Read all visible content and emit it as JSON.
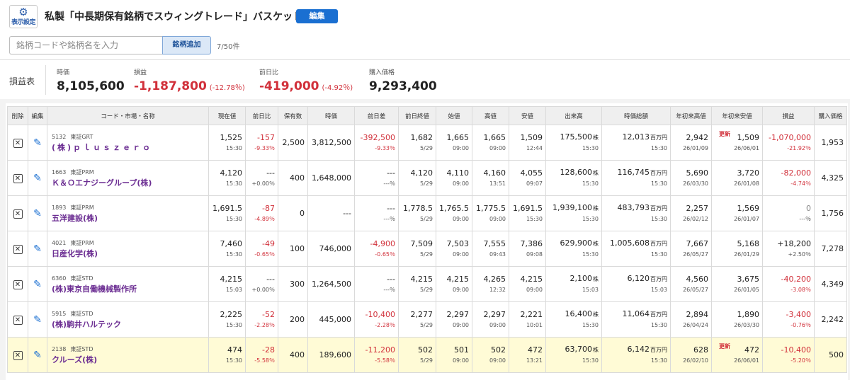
{
  "header": {
    "settings_label": "表示設定",
    "title": "私製「中長期保有銘柄でスウィングトレード」バスケット",
    "edit_label": "編集"
  },
  "search": {
    "placeholder": "銘柄コードや銘柄名を入力",
    "value": "",
    "add_label": "銘柄追加",
    "count": "7/50件"
  },
  "summary": {
    "label": "損益表",
    "market_value_label": "時価",
    "market_value": "8,105,600",
    "pl_label": "損益",
    "pl": "-1,187,800",
    "pl_pct": "(-12.78％)",
    "dod_label": "前日比",
    "dod": "-419,000",
    "dod_pct": "(-4.92％)",
    "cost_label": "購入価格",
    "cost": "9,293,400"
  },
  "table": {
    "headers": {
      "delete": "削除",
      "edit": "編集",
      "name": "コード・市場・名称",
      "price": "現在値",
      "change": "前日比",
      "qty": "保有数",
      "value": "時価",
      "diff": "前日差",
      "prev": "前日終値",
      "open": "始値",
      "high": "高値",
      "low": "安値",
      "volume": "出来高",
      "mcap": "時価総額",
      "ytd_high": "年初来高値",
      "ytd_low": "年初来安値",
      "pl": "損益",
      "cost": "購入価格"
    },
    "rows": [
      {
        "code": "5132",
        "market": "東証GRT",
        "name": "(株)ｐｌｕｓｚｅｒｏ",
        "price": "1,525",
        "price_time": "15:30",
        "chg": "-157",
        "chg_pct": "-9.33％",
        "qty": "2,500",
        "value": "3,812,500",
        "diff": "-392,500",
        "diff_pct": "-9.33％",
        "prev": "1,682",
        "prev_date": "5/29",
        "open": "1,665",
        "open_time": "09:00",
        "high": "1,665",
        "high_time": "09:00",
        "low": "1,509",
        "low_time": "12:44",
        "vol": "175,500",
        "vol_unit": "株",
        "vol_time": "15:30",
        "mcap": "12,013",
        "mcap_unit": "百万円",
        "mcap_time": "15:30",
        "ytdh": "2,942",
        "ytdh_date": "26/01/09",
        "ytdl_badge": "更新",
        "ytdl": "1,509",
        "ytdl_date": "26/06/01",
        "pl": "-1,070,000",
        "pl_pct": "-21.92％",
        "cost": "1,953"
      },
      {
        "code": "1663",
        "market": "東証PRM",
        "name": "Ｋ＆Ｏエナジーグループ(株)",
        "price": "4,120",
        "price_time": "15:30",
        "chg": "---",
        "chg_pct": "+0.00％",
        "qty": "400",
        "value": "1,648,000",
        "diff": "---",
        "diff_pct": "---％",
        "prev": "4,120",
        "prev_date": "5/29",
        "open": "4,110",
        "open_time": "09:00",
        "high": "4,160",
        "high_time": "13:51",
        "low": "4,055",
        "low_time": "09:07",
        "vol": "128,600",
        "vol_unit": "株",
        "vol_time": "15:30",
        "mcap": "116,745",
        "mcap_unit": "百万円",
        "mcap_time": "15:30",
        "ytdh": "5,690",
        "ytdh_date": "26/03/30",
        "ytdl_badge": "",
        "ytdl": "3,720",
        "ytdl_date": "26/01/08",
        "pl": "-82,000",
        "pl_pct": "-4.74％",
        "cost": "4,325"
      },
      {
        "code": "1893",
        "market": "東証PRM",
        "name": "五洋建設(株)",
        "price": "1,691.5",
        "price_time": "15:30",
        "chg": "-87",
        "chg_pct": "-4.89％",
        "qty": "0",
        "value": "---",
        "diff": "---",
        "diff_pct": "---％",
        "prev": "1,778.5",
        "prev_date": "5/29",
        "open": "1,765.5",
        "open_time": "09:00",
        "high": "1,775.5",
        "high_time": "09:00",
        "low": "1,691.5",
        "low_time": "15:30",
        "vol": "1,939,100",
        "vol_unit": "株",
        "vol_time": "15:30",
        "mcap": "483,793",
        "mcap_unit": "百万円",
        "mcap_time": "15:30",
        "ytdh": "2,257",
        "ytdh_date": "26/02/12",
        "ytdl_badge": "",
        "ytdl": "1,569",
        "ytdl_date": "26/01/07",
        "pl": "0",
        "pl_pct": "---％",
        "cost": "1,756"
      },
      {
        "code": "4021",
        "market": "東証PRM",
        "name": "日産化学(株)",
        "price": "7,460",
        "price_time": "15:30",
        "chg": "-49",
        "chg_pct": "-0.65％",
        "qty": "100",
        "value": "746,000",
        "diff": "-4,900",
        "diff_pct": "-0.65％",
        "prev": "7,509",
        "prev_date": "5/29",
        "open": "7,503",
        "open_time": "09:00",
        "high": "7,555",
        "high_time": "09:43",
        "low": "7,386",
        "low_time": "09:08",
        "vol": "629,900",
        "vol_unit": "株",
        "vol_time": "15:30",
        "mcap": "1,005,608",
        "mcap_unit": "百万円",
        "mcap_time": "15:30",
        "ytdh": "7,667",
        "ytdh_date": "26/05/27",
        "ytdl_badge": "",
        "ytdl": "5,168",
        "ytdl_date": "26/01/29",
        "pl": "+18,200",
        "pl_pct": "+2.50％",
        "cost": "7,278"
      },
      {
        "code": "6360",
        "market": "東証STD",
        "name": "(株)東京自働機械製作所",
        "price": "4,215",
        "price_time": "15:03",
        "chg": "---",
        "chg_pct": "+0.00％",
        "qty": "300",
        "value": "1,264,500",
        "diff": "---",
        "diff_pct": "---％",
        "prev": "4,215",
        "prev_date": "5/29",
        "open": "4,215",
        "open_time": "09:00",
        "high": "4,265",
        "high_time": "12:32",
        "low": "4,215",
        "low_time": "09:00",
        "vol": "2,100",
        "vol_unit": "株",
        "vol_time": "15:03",
        "mcap": "6,120",
        "mcap_unit": "百万円",
        "mcap_time": "15:03",
        "ytdh": "4,560",
        "ytdh_date": "26/05/27",
        "ytdl_badge": "",
        "ytdl": "3,675",
        "ytdl_date": "26/01/05",
        "pl": "-40,200",
        "pl_pct": "-3.08％",
        "cost": "4,349"
      },
      {
        "code": "5915",
        "market": "東証STD",
        "name": "(株)駒井ハルテック",
        "price": "2,225",
        "price_time": "15:30",
        "chg": "-52",
        "chg_pct": "-2.28％",
        "qty": "200",
        "value": "445,000",
        "diff": "-10,400",
        "diff_pct": "-2.28％",
        "prev": "2,277",
        "prev_date": "5/29",
        "open": "2,297",
        "open_time": "09:00",
        "high": "2,297",
        "high_time": "09:00",
        "low": "2,221",
        "low_time": "10:01",
        "vol": "16,400",
        "vol_unit": "株",
        "vol_time": "15:30",
        "mcap": "11,064",
        "mcap_unit": "百万円",
        "mcap_time": "15:30",
        "ytdh": "2,894",
        "ytdh_date": "26/04/24",
        "ytdl_badge": "",
        "ytdl": "1,890",
        "ytdl_date": "26/03/30",
        "pl": "-3,400",
        "pl_pct": "-0.76％",
        "cost": "2,242"
      },
      {
        "code": "2138",
        "market": "東証STD",
        "name": "クルーズ(株)",
        "price": "474",
        "price_time": "15:30",
        "chg": "-28",
        "chg_pct": "-5.58％",
        "qty": "400",
        "value": "189,600",
        "diff": "-11,200",
        "diff_pct": "-5.58％",
        "prev": "502",
        "prev_date": "5/29",
        "open": "501",
        "open_time": "09:00",
        "high": "502",
        "high_time": "09:00",
        "low": "472",
        "low_time": "13:21",
        "vol": "63,700",
        "vol_unit": "株",
        "vol_time": "15:30",
        "mcap": "6,142",
        "mcap_unit": "百万円",
        "mcap_time": "15:30",
        "ytdh": "628",
        "ytdh_date": "26/02/10",
        "ytdl_badge": "更新",
        "ytdl": "472",
        "ytdl_date": "26/06/01",
        "pl": "-10,400",
        "pl_pct": "-5.20％",
        "cost": "500"
      }
    ]
  },
  "colors": {
    "accent": "#1a6fd1",
    "negative": "#d1303a",
    "name": "#6b2d92",
    "highlight": "#fffbd6"
  }
}
